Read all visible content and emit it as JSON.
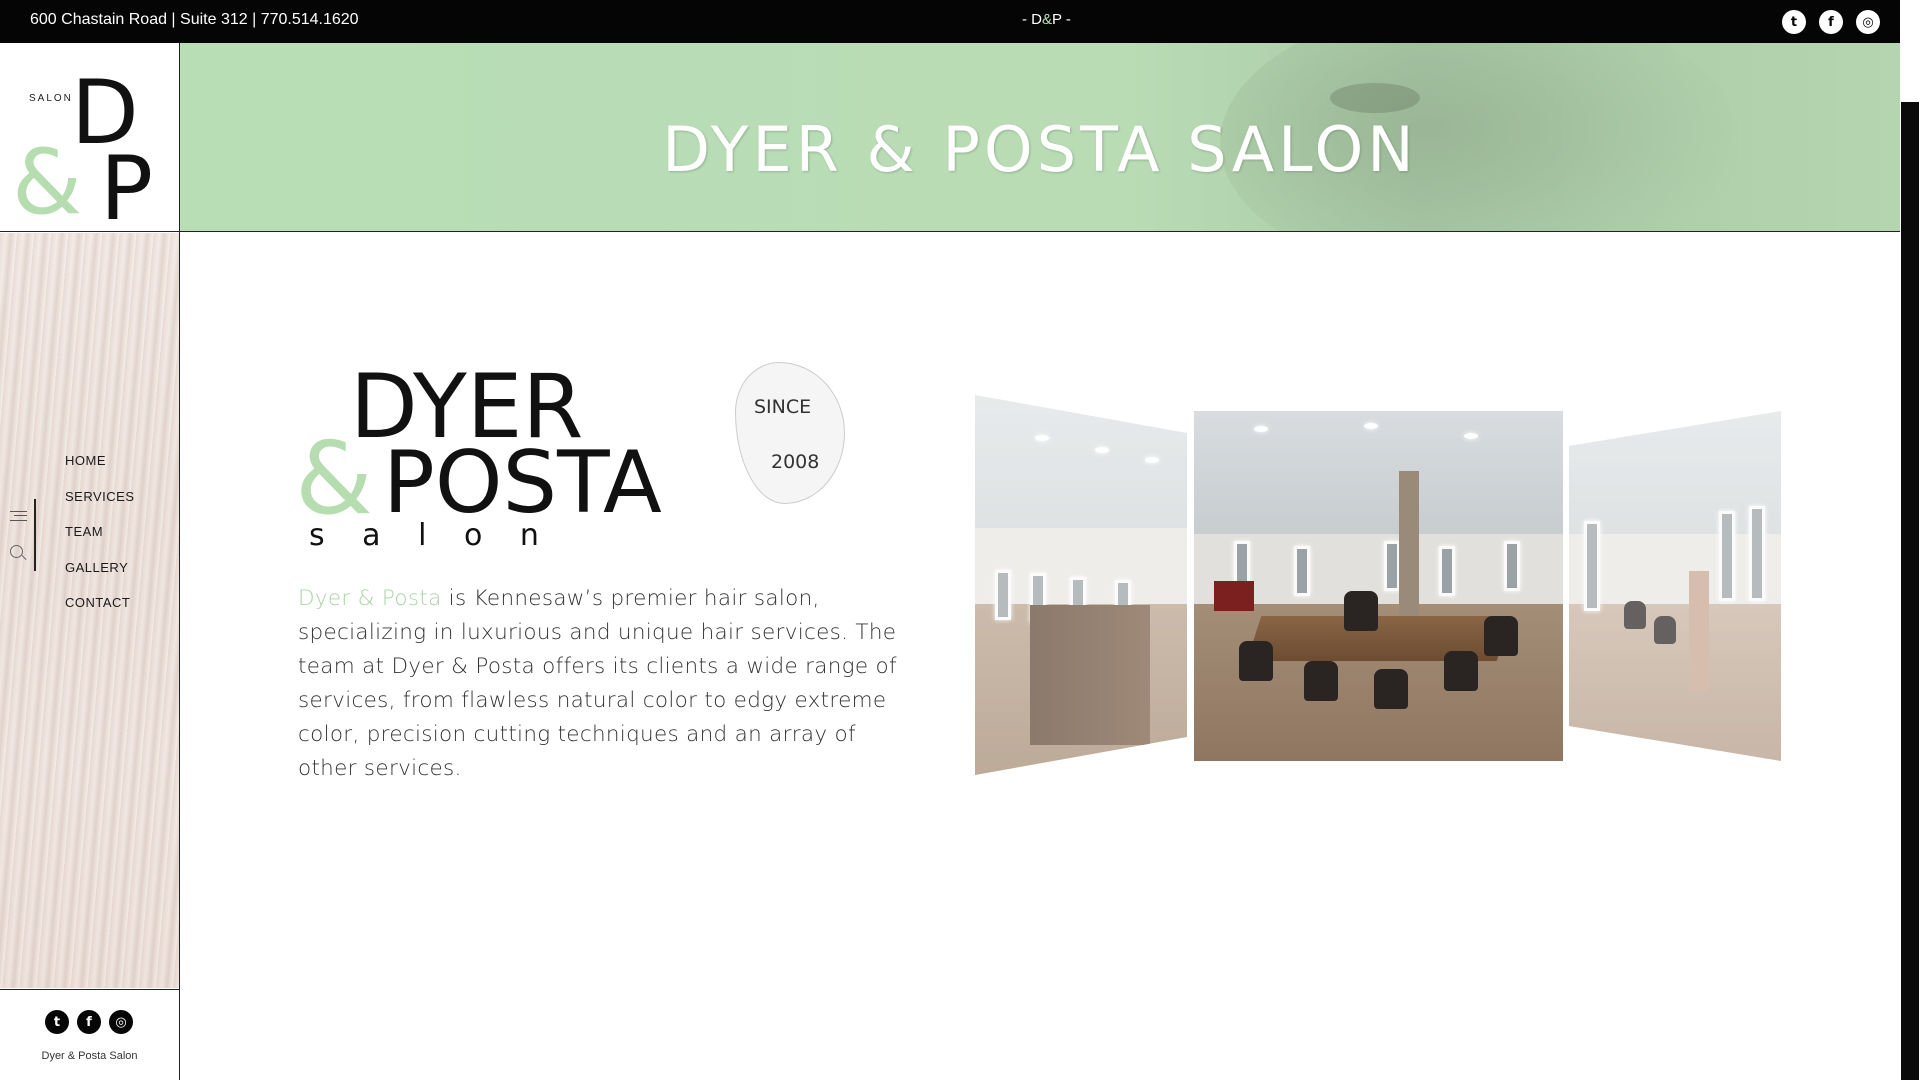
{
  "topbar": {
    "address": "600 Chastain Road | Suite 312 | 770.514.1620",
    "center_prefix": "- D",
    "center_amp": "&",
    "center_suffix": "P -",
    "socials": [
      {
        "icon": "twitter-icon",
        "glyph": "t"
      },
      {
        "icon": "facebook-icon",
        "glyph": "f"
      },
      {
        "icon": "instagram-icon",
        "glyph": "◎"
      }
    ]
  },
  "sidebar": {
    "logo": {
      "salon": "SALON",
      "letter1": "D",
      "amp": "&",
      "letter2": "P"
    },
    "nav": [
      {
        "label": "HOME"
      },
      {
        "label": "SERVICES"
      },
      {
        "label": "TEAM"
      },
      {
        "label": "GALLERY"
      },
      {
        "label": "CONTACT"
      }
    ],
    "footer_caption": "Dyer & Posta Salon"
  },
  "hero": {
    "title": "DYER & POSTA SALON"
  },
  "main": {
    "logo": {
      "line1": "DYER",
      "amp": "&",
      "line2": "POSTA",
      "line3": "s a l o n"
    },
    "since_label": "SINCE",
    "since_year": "2008",
    "desc_brand": "Dyer & Posta",
    "desc_rest": " is Kennesaw’s premier hair salon, specializing in luxurious and unique hair services. The team at Dyer & Posta offers its clients a wide range of services, from flawless natural color to edgy extreme color, precision cutting techniques and an array of other services."
  },
  "colors": {
    "accent_green": "#a9d3a4",
    "hero_green": "#b8deb6",
    "black": "#050505"
  }
}
